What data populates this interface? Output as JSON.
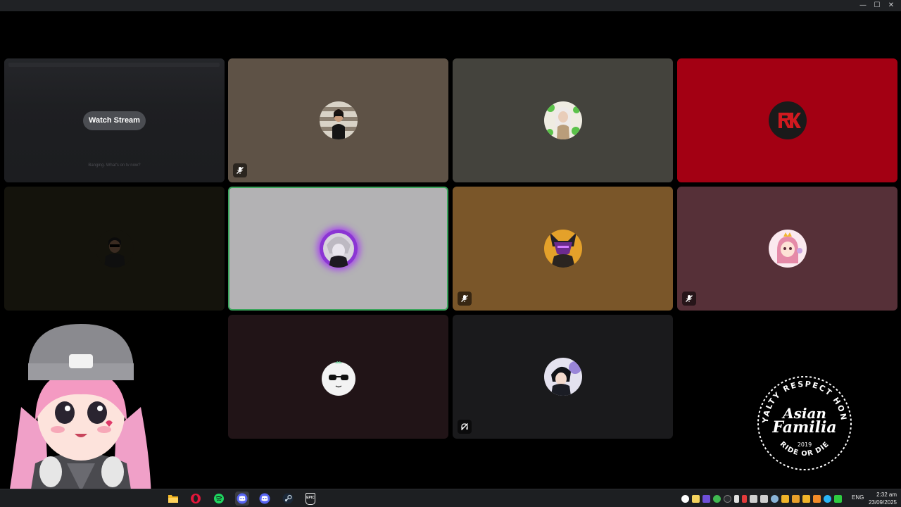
{
  "window": {
    "minimize_glyph": "—",
    "maximize_glyph": "☐",
    "close_glyph": "✕"
  },
  "stream_tile": {
    "watch_button_label": "Watch Stream",
    "caption": "Banging. What's on tv now?"
  },
  "participants": [
    {
      "id": "p1",
      "bg": "#5e5246",
      "avatar": "girl-sunglasses",
      "muted": true
    },
    {
      "id": "p2",
      "bg": "#44433d",
      "avatar": "clover-girl",
      "muted": false
    },
    {
      "id": "p3",
      "bg": "#a30013",
      "avatar": "rk-logo",
      "muted": false
    },
    {
      "id": "p4",
      "bg": "#14130c",
      "avatar": "dark-person",
      "muted": false
    },
    {
      "id": "p5",
      "bg": "#b3b2b4",
      "avatar": "purple-glow-character",
      "muted": false,
      "speaking": true
    },
    {
      "id": "p6",
      "bg": "#7a5629",
      "avatar": "masked-warrior",
      "muted": true
    },
    {
      "id": "p7",
      "bg": "#563038",
      "avatar": "pink-hair-girl",
      "muted": true
    },
    {
      "id": "p8",
      "bg": "#211417",
      "avatar": "panda-sunglasses",
      "muted": false
    },
    {
      "id": "p9",
      "bg": "#1a1a1c",
      "avatar": "anime-boy",
      "muted": false,
      "deafened": true
    }
  ],
  "logo": {
    "top_arc": "LOYALTY RESPECT HONOR",
    "line1": "Asian",
    "line2": "Familia",
    "year": "2019",
    "bottom_arc": "RIDE OR DIE"
  },
  "taskbar": {
    "apps": [
      {
        "name": "file-explorer",
        "color": "#f4b927"
      },
      {
        "name": "opera",
        "color": "#e3163a"
      },
      {
        "name": "spotify",
        "color": "#1ed760"
      },
      {
        "name": "discord",
        "color": "#5865f2",
        "active": true
      },
      {
        "name": "discord-2",
        "color": "#5865f2"
      },
      {
        "name": "steam",
        "color": "#c7d5e0"
      },
      {
        "name": "epic-games",
        "color": "#e6e6e6",
        "label": "EPIC"
      }
    ],
    "language": "ENG",
    "time": "2:32 am",
    "date": "23/09/2025"
  }
}
